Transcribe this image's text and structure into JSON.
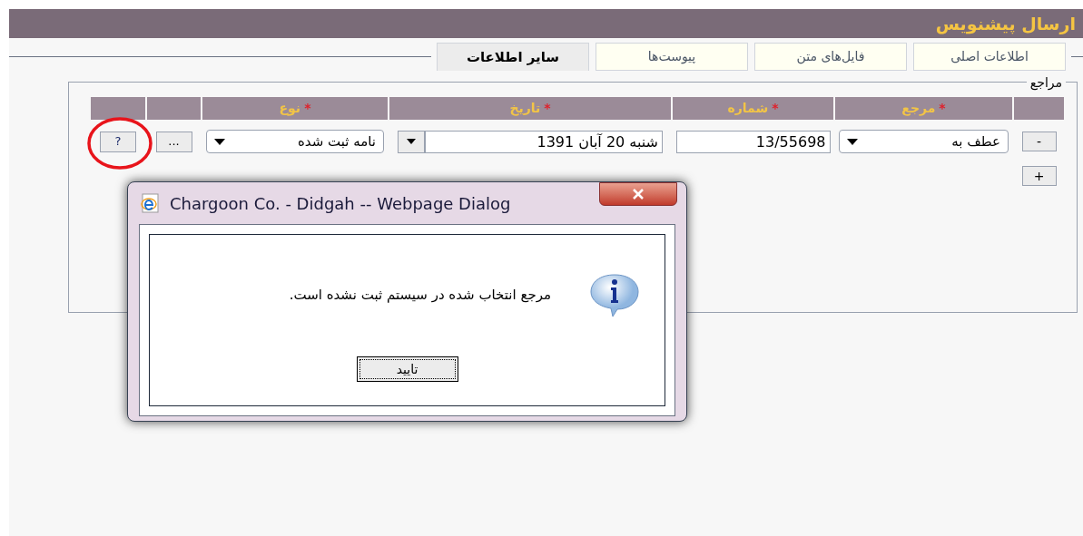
{
  "header": {
    "title": "ارسال پیشنویس"
  },
  "tabs": [
    {
      "label": "اطلاعات اصلی",
      "selected": false
    },
    {
      "label": "فایل‌های متن",
      "selected": false
    },
    {
      "label": "پیوست‌ها",
      "selected": false
    },
    {
      "label": "سایر اطلاعات",
      "selected": true
    }
  ],
  "references": {
    "legend": "مراجع",
    "columns": [
      {
        "label": "مرجع",
        "mark": "*"
      },
      {
        "label": "شماره",
        "mark": "*"
      },
      {
        "label": "تاریخ",
        "mark": "*"
      },
      {
        "label": "نوع",
        "mark": "*"
      }
    ],
    "rows": [
      {
        "remove": "-",
        "reference": "عطف به",
        "number": "13/55698",
        "date": "شنبه 20 آبان 1391",
        "type": "نامه ثبت شده",
        "browse": "...",
        "help": "?"
      }
    ],
    "add_button": "+"
  },
  "dialog": {
    "title": "Chargoon Co. - Didgah -- Webpage Dialog",
    "message": "مرجع انتخاب شده در سیستم ثبت نشده است.",
    "ok_button": "تایید"
  }
}
